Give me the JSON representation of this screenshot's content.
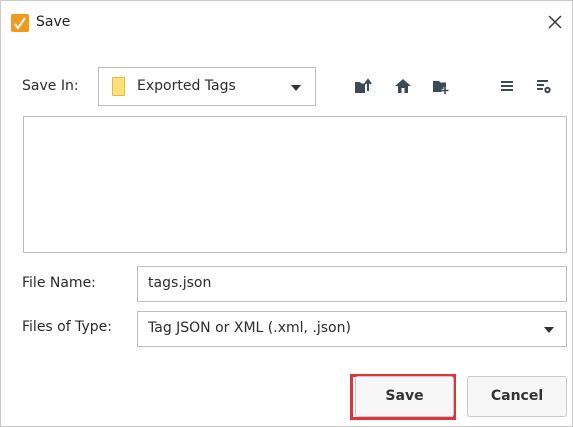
{
  "window": {
    "title": "Save",
    "icon": "ignition-app-icon",
    "close_icon": "close-icon"
  },
  "save_in": {
    "label": "Save In:",
    "selected_folder": "Exported Tags",
    "folder_icon": "folder-icon"
  },
  "toolbar": {
    "buttons": [
      "up-one-level-icon",
      "home-icon",
      "new-folder-icon",
      "list-view-icon",
      "details-view-icon"
    ]
  },
  "file_name": {
    "label": "File Name:",
    "value": "tags.json"
  },
  "file_type": {
    "label": "Files of Type:",
    "selected": "Tag JSON or XML (.xml, .json)"
  },
  "buttons": {
    "save": "Save",
    "cancel": "Cancel"
  },
  "colors": {
    "accent": "#f39a1c",
    "highlight": "#e0323b",
    "folder": "#ffe07a"
  }
}
